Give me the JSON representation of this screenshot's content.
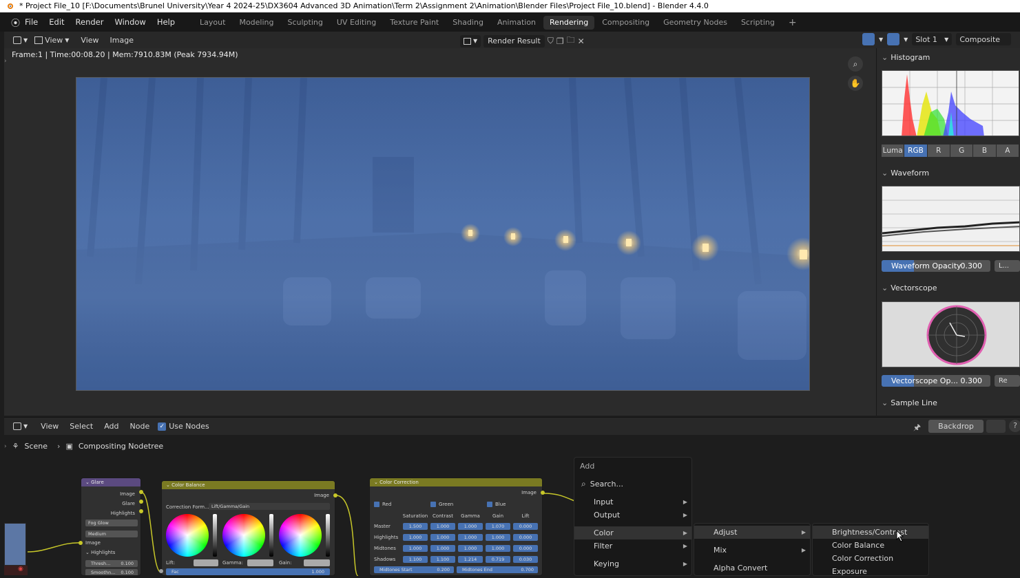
{
  "window": {
    "title": "* Project File_10 [F:\\Documents\\Brunel University\\Year 4 2024-25\\DX3604 Advanced 3D Animation\\Term 2\\Assignment 2\\Animation\\Blender Files\\Project File_10.blend] - Blender 4.4.0"
  },
  "topbar": {
    "menus": [
      "File",
      "Edit",
      "Render",
      "Window",
      "Help"
    ],
    "workspaces": [
      "Layout",
      "Modeling",
      "Sculpting",
      "UV Editing",
      "Texture Paint",
      "Shading",
      "Animation",
      "Rendering",
      "Compositing",
      "Geometry Nodes",
      "Scripting"
    ],
    "active_workspace": "Rendering",
    "add_tab": "+"
  },
  "image_editor": {
    "view_mode": "View",
    "menus": [
      "View",
      "Image"
    ],
    "image_name": "Render Result",
    "slot": "Slot 1",
    "layer": "Composite",
    "status": "Frame:1 | Time:00:08.20 | Mem:7910.83M (Peak 7934.94M)"
  },
  "scopes": {
    "histogram": {
      "title": "Histogram",
      "channels": [
        "Luma",
        "RGB",
        "R",
        "G",
        "B",
        "A"
      ],
      "active_channel": "RGB"
    },
    "waveform": {
      "title": "Waveform",
      "opacity_label": "Waveform Opacity",
      "opacity_value": "0.300",
      "opacity_fraction": 0.3,
      "mode_label": "L..."
    },
    "vectorscope": {
      "title": "Vectorscope",
      "opacity_label": "Vectorscope Op...",
      "opacity_value": "0.300",
      "opacity_fraction": 0.3,
      "mode_label": "Re"
    },
    "sample_line": {
      "title": "Sample Line"
    }
  },
  "node_editor": {
    "menus": [
      "View",
      "Select",
      "Add",
      "Node"
    ],
    "use_nodes_label": "Use Nodes",
    "use_nodes": true,
    "backdrop_label": "Backdrop",
    "breadcrumb": [
      "Scene",
      "Compositing Nodetree"
    ],
    "glare_node": {
      "title": "Glare",
      "outputs": [
        "Image",
        "Glare",
        "Highlights"
      ],
      "type": "Fog Glow",
      "quality": "Medium",
      "input_image": "Image",
      "highlights_label": "Highlights",
      "threshold_label": "Thresh...",
      "threshold_value": "0.100",
      "smooth_label": "Smoothn...",
      "smooth_value": "0.100"
    },
    "color_balance_node": {
      "title": "Color Balance",
      "output": "Image",
      "formula_label": "Correction Form...",
      "formula_value": "Lift/Gamma/Gain",
      "lift_label": "Lift:",
      "gamma_label": "Gamma:",
      "gain_label": "Gain:",
      "fac_label": "Fac",
      "fac_value": "1.000"
    },
    "color_correction_node": {
      "title": "Color Correction",
      "output": "Image",
      "channels": [
        "Red",
        "Green",
        "Blue"
      ],
      "columns": [
        "Saturation",
        "Contrast",
        "Gamma",
        "Gain",
        "Lift"
      ],
      "rows": [
        {
          "label": "Master",
          "values": [
            "1.500",
            "1.000",
            "1.000",
            "1.070",
            "0.000"
          ]
        },
        {
          "label": "Highlights",
          "values": [
            "1.000",
            "1.000",
            "1.000",
            "1.000",
            "0.000"
          ]
        },
        {
          "label": "Midtones",
          "values": [
            "1.000",
            "1.000",
            "1.000",
            "1.000",
            "0.000"
          ]
        },
        {
          "label": "Shadows",
          "values": [
            "1.100",
            "1.100",
            "1.214",
            "0.719",
            "0.030"
          ]
        }
      ],
      "midtones_start_label": "Midtones Start",
      "midtones_start_value": "0.200",
      "midtones_end_label": "Midtones End",
      "midtones_end_value": "0.700"
    },
    "add_menu": {
      "title": "Add",
      "search_placeholder": "Search...",
      "items": [
        "Input",
        "Output",
        "Color",
        "Filter",
        "Keying"
      ],
      "highlighted": "Color",
      "color_submenu": [
        "Adjust",
        "Mix",
        "Alpha Convert"
      ],
      "adjust_submenu": [
        "Brightness/Contrast",
        "Color Balance",
        "Color Correction",
        "Exposure"
      ]
    }
  },
  "colors": {
    "accent": "#4772b3",
    "socket_yellow": "#c7c729",
    "render_blue": "#476aa4",
    "glare_header": "#5b4a80",
    "color_header": "#7a7a22"
  }
}
